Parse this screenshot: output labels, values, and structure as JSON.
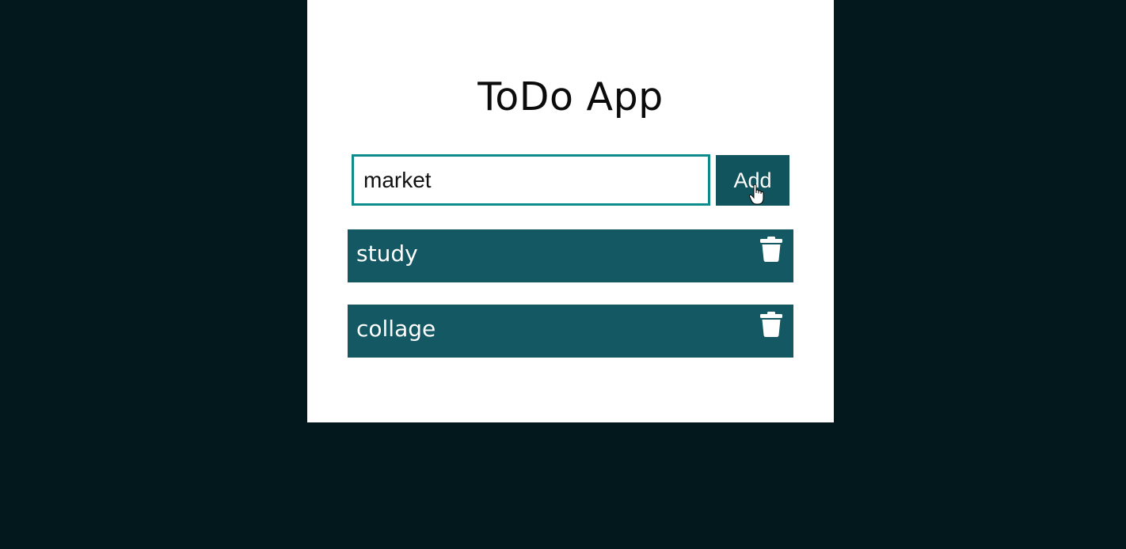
{
  "app": {
    "title": "ToDo App"
  },
  "form": {
    "input_value": "market",
    "add_label": "Add"
  },
  "todos": [
    {
      "text": "study",
      "delete_icon": "trash-icon"
    },
    {
      "text": "collage",
      "delete_icon": "trash-icon"
    }
  ],
  "colors": {
    "page_background": "#03181d",
    "card_background": "#ffffff",
    "accent": "#135863",
    "input_border": "#0e8b8b"
  }
}
